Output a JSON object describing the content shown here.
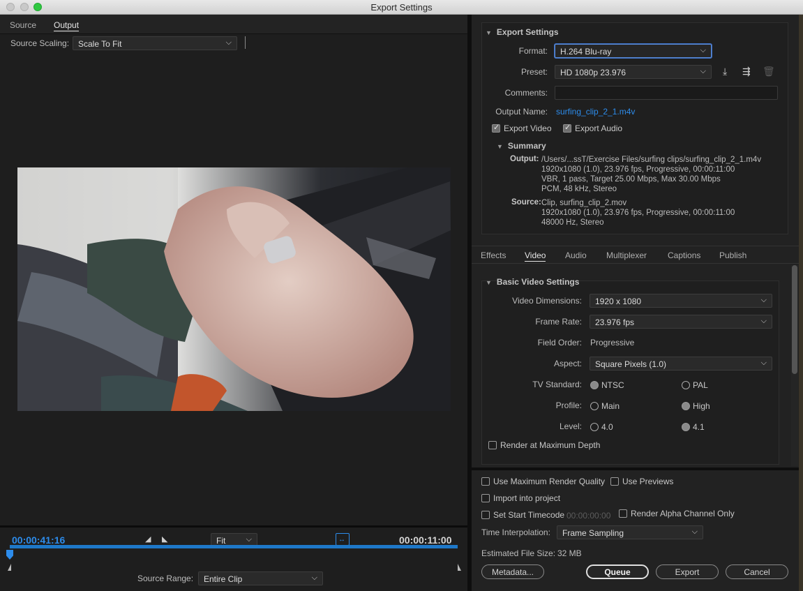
{
  "window": {
    "title": "Export Settings"
  },
  "left": {
    "tabs": [
      "Source",
      "Output"
    ],
    "active_tab": "Output",
    "scaling": {
      "label": "Source Scaling:",
      "value": "Scale To Fit"
    },
    "timecode_current": "00:00:41:16",
    "timecode_duration": "00:00:11:00",
    "zoom": "Fit",
    "source_range": {
      "label": "Source Range:",
      "value": "Entire Clip"
    }
  },
  "export_settings": {
    "heading": "Export Settings",
    "format_label": "Format:",
    "format_value": "H.264 Blu-ray",
    "preset_label": "Preset:",
    "preset_value": "HD 1080p 23.976",
    "comments_label": "Comments:",
    "output_name_label": "Output Name:",
    "output_name": "surfing_clip_2_1.m4v",
    "export_video": "Export Video",
    "export_audio": "Export Audio",
    "summary_heading": "Summary",
    "output_key": "Output:",
    "output_lines": [
      "/Users/...ssT/Exercise Files/surfing clips/surfing_clip_2_1.m4v",
      "1920x1080 (1.0), 23.976 fps, Progressive, 00:00:11:00",
      "VBR, 1 pass, Target 25.00 Mbps, Max 30.00 Mbps",
      "PCM, 48 kHz, Stereo"
    ],
    "source_key": "Source:",
    "source_lines": [
      "Clip, surfing_clip_2.mov",
      "1920x1080 (1.0), 23.976 fps, Progressive, 00:00:11:00",
      "48000 Hz, Stereo"
    ]
  },
  "tabs": [
    "Effects",
    "Video",
    "Audio",
    "Multiplexer",
    "Captions",
    "Publish"
  ],
  "active_tab": "Video",
  "video": {
    "heading": "Basic Video Settings",
    "dimensions_label": "Video Dimensions:",
    "dimensions": "1920 x 1080",
    "frame_rate_label": "Frame Rate:",
    "frame_rate": "23.976 fps",
    "field_order_label": "Field Order:",
    "field_order": "Progressive",
    "aspect_label": "Aspect:",
    "aspect": "Square Pixels (1.0)",
    "tv_label": "TV Standard:",
    "tv_options": [
      "NTSC",
      "PAL"
    ],
    "profile_label": "Profile:",
    "profile_options": [
      "Main",
      "High"
    ],
    "level_label": "Level:",
    "level_options": [
      "4.0",
      "4.1"
    ],
    "render_max_depth": "Render at Maximum Depth"
  },
  "footer": {
    "max_quality": "Use Maximum Render Quality",
    "use_previews": "Use Previews",
    "import_project": "Import into project",
    "start_timecode": "Set Start Timecode",
    "start_timecode_value": "00:00:00:00",
    "alpha_only": "Render Alpha Channel Only",
    "interp_label": "Time Interpolation:",
    "interp_value": "Frame Sampling",
    "filesize_label": "Estimated File Size:",
    "filesize_value": "32 MB",
    "metadata_btn": "Metadata...",
    "queue_btn": "Queue",
    "export_btn": "Export",
    "cancel_btn": "Cancel"
  }
}
